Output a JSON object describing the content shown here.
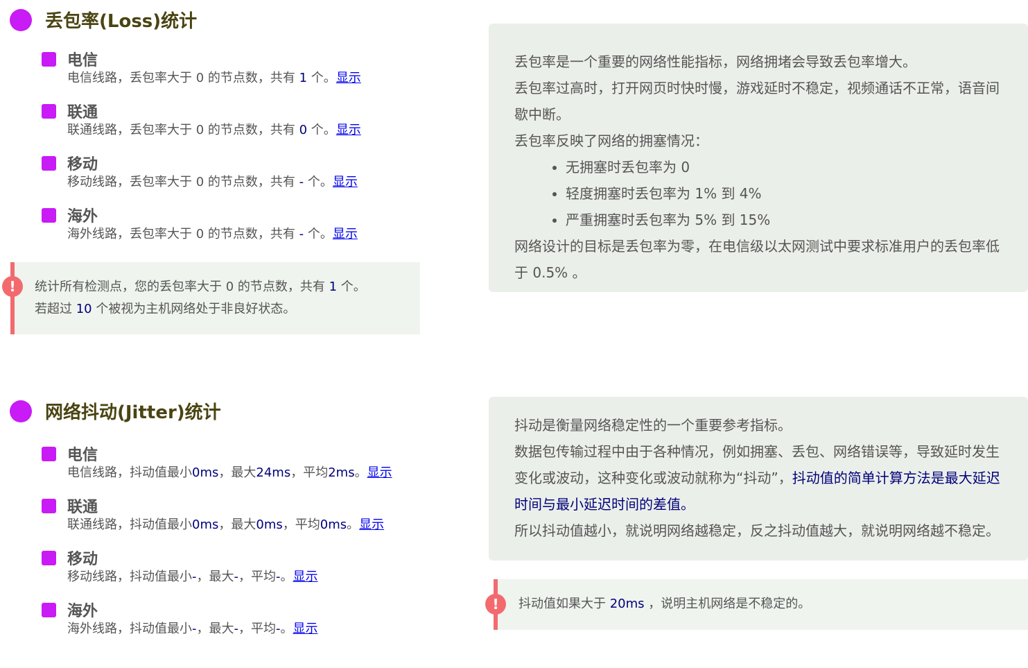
{
  "loss": {
    "title": "丢包率(Loss)统计",
    "items": [
      {
        "name": "电信",
        "prefix": "电信线路，丢包率大于 0 的节点数，共有 ",
        "count": "1",
        "suffix": " 个。",
        "link": "显示"
      },
      {
        "name": "联通",
        "prefix": "联通线路，丢包率大于 0 的节点数，共有 ",
        "count": "0",
        "suffix": " 个。",
        "link": "显示"
      },
      {
        "name": "移动",
        "prefix": "移动线路，丢包率大于 0 的节点数，共有 ",
        "count": "-",
        "suffix": " 个。",
        "link": "显示"
      },
      {
        "name": "海外",
        "prefix": "海外线路，丢包率大于 0 的节点数，共有 ",
        "count": "-",
        "suffix": " 个。",
        "link": "显示"
      }
    ],
    "alert": {
      "icon": "!",
      "line1_prefix": "统计所有检测点，您的丢包率大于 0 的节点数，共有 ",
      "line1_count": "1",
      "line1_suffix": " 个。",
      "line2_prefix": "若超过 ",
      "line2_threshold": "10",
      "line2_suffix": " 个被视为主机网络处于非良好状态。"
    },
    "info": {
      "p1": "丢包率是一个重要的网络性能指标，网络拥堵会导致丢包率增大。",
      "p2a": "丢包率过高时，打开网页时快时慢，游戏延时不稳定，视频通话不正常，语音间",
      "p2b": "歇中断。",
      "p3": "丢包率反映了网络的拥塞情况：",
      "bullets": [
        "无拥塞时丢包率为 0",
        "轻度拥塞时丢包率为 1% 到 4%",
        "严重拥塞时丢包率为 5% 到 15%"
      ],
      "p4a": "网络设计的目标是丢包率为零，在电信级以太网测试中要求标准用户的丢包率低",
      "p4b": "于 0.5% 。"
    }
  },
  "jitter": {
    "title": "网络抖动(Jitter)统计",
    "items": [
      {
        "name": "电信",
        "pre": "电信线路，抖动值最小",
        "min": "0ms",
        "mid1": "，最大",
        "max": "24ms",
        "mid2": "，平均",
        "avg": "2ms",
        "end": "。",
        "link": "显示"
      },
      {
        "name": "联通",
        "pre": "联通线路，抖动值最小",
        "min": "0ms",
        "mid1": "，最大",
        "max": "0ms",
        "mid2": "，平均",
        "avg": "0ms",
        "end": "。",
        "link": "显示"
      },
      {
        "name": "移动",
        "pre": "移动线路，抖动值最小",
        "min": "-",
        "mid1": "，最大",
        "max": "-",
        "mid2": "，平均",
        "avg": "-",
        "end": "。",
        "link": "显示"
      },
      {
        "name": "海外",
        "pre": "海外线路，抖动值最小",
        "min": "-",
        "mid1": "，最大",
        "max": "-",
        "mid2": "，平均",
        "avg": "-",
        "end": "。",
        "link": "显示"
      }
    ],
    "info": {
      "p1": "抖动是衡量网络稳定性的一个重要参考指标。",
      "p2a": "数据包传输过程中由于各种情况，例如拥塞、丢包、网络错误等，导致延时发生",
      "p2b_plain": "变化或波动，这种变化或波动就称为“抖动”，",
      "p2b_strong": "抖动值的简单计算方法是最大延迟",
      "p2c_strong": "时间与最小延迟时间的差值。",
      "p3": "所以抖动值越小，就说明网络越稳定，反之抖动值越大，就说明网络越不稳定。"
    },
    "alert": {
      "icon": "!",
      "prefix": "抖动值如果大于 ",
      "threshold": "20ms",
      "suffix": " ，说明主机网络是不稳定的。"
    }
  },
  "colors": {
    "accent": "#c81bf5",
    "heading": "#4a4412",
    "alert": "#f36a6e",
    "link": "#0000ee",
    "number": "#00007a"
  }
}
